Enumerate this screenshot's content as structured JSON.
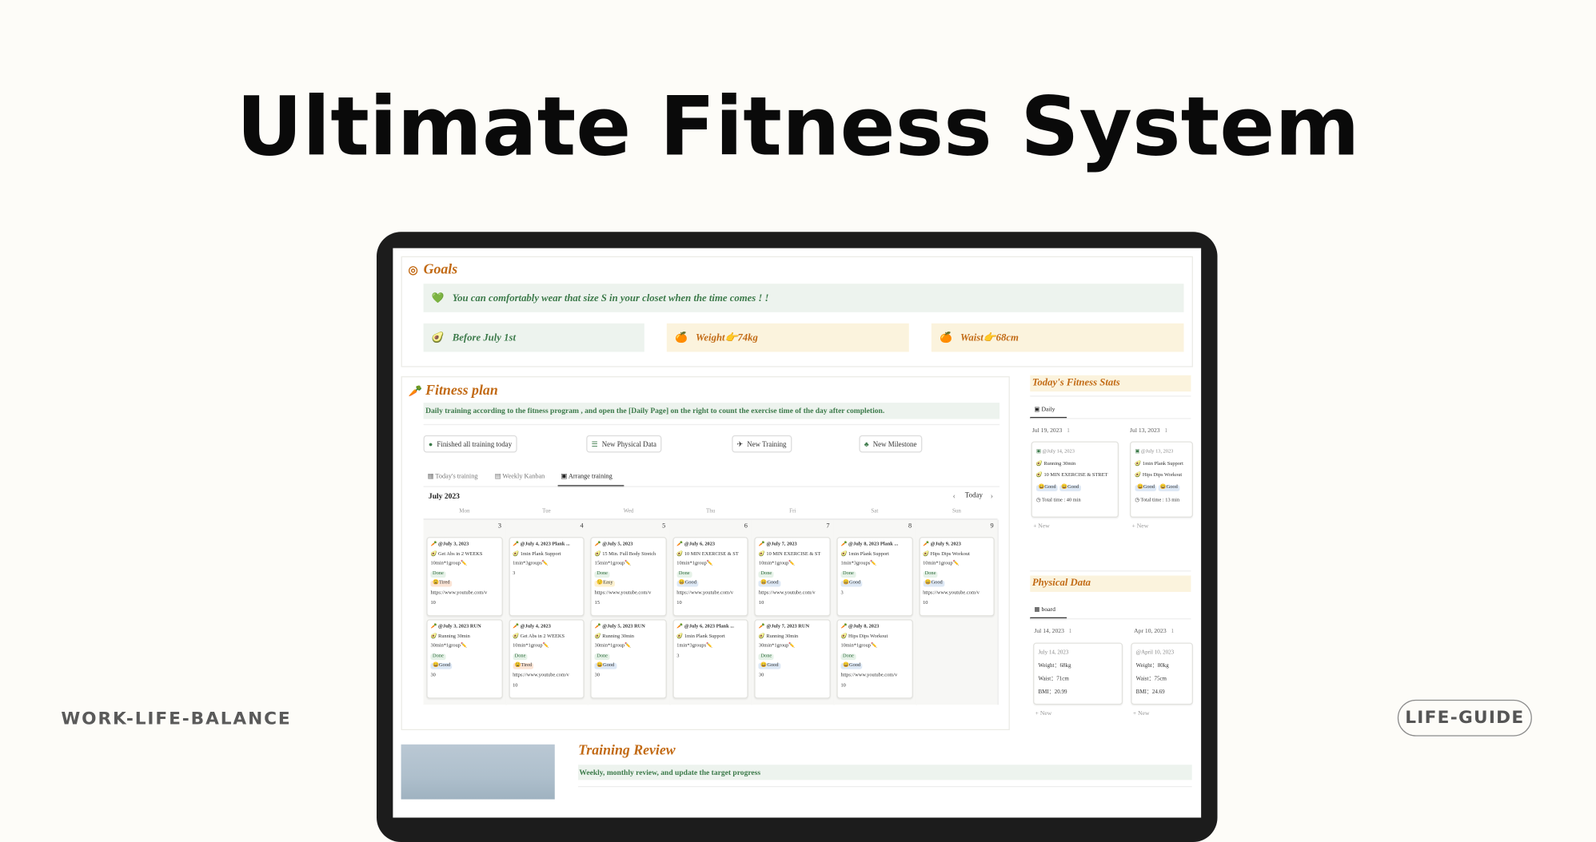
{
  "header": {
    "title": "Ultimate Fitness System"
  },
  "brand": {
    "left": "WORK-LIFE-BALANCE",
    "right": "LIFE-GUIDE"
  },
  "goals": {
    "title": "Goals",
    "banner": "You can comfortably wear that size S in your closet when the time comes ! !",
    "cards": [
      "Before July 1st",
      "Weight👉74kg",
      "Waist👉68cm"
    ]
  },
  "plan": {
    "title": "Fitness plan",
    "desc": "Daily training according to the fitness program , and open the [Daily Page] on the right to count the exercise time of the day after completion.",
    "buttons": [
      "Finished all training today",
      "New Physical Data",
      "New Training",
      "New Milestone"
    ],
    "tabs": [
      "Today's training",
      "Weekly Kanban",
      "Arrange training"
    ],
    "month": "July 2023",
    "today": "Today",
    "weekdays": [
      "Mon",
      "Tue",
      "Wed",
      "Thu",
      "Fri",
      "Sat",
      "Sun"
    ],
    "days": [
      "3",
      "4",
      "5",
      "6",
      "7",
      "8",
      "9"
    ],
    "row1": [
      {
        "t": "@July 3, 2023",
        "e": "Get Abs in 2 WEEKS",
        "r": "10min*1group✏️",
        "s": "Done",
        "f": "😩Tired",
        "u": "https://www.youtube.com/v",
        "n": "10"
      },
      {
        "t": "@July 4, 2023 Plank ...",
        "e": "1min Plank Support",
        "r": "1min*3groups✏️",
        "s": "",
        "f": "",
        "u": "",
        "n": "3"
      },
      {
        "t": "@July 5, 2023",
        "e": "15 Min. Full Body Stretch",
        "r": "15min*1group✏️",
        "s": "Done",
        "f": "😌Easy",
        "u": "https://www.youtube.com/v",
        "n": "15"
      },
      {
        "t": "@July 6, 2023",
        "e": "10 MIN EXERCISE & ST",
        "r": "10min*1group✏️",
        "s": "Done",
        "f": "😄Good",
        "u": "https://www.youtube.com/v",
        "n": "10"
      },
      {
        "t": "@July 7, 2023",
        "e": "10 MIN EXERCISE & ST",
        "r": "10min*1group✏️",
        "s": "Done",
        "f": "😄Good",
        "u": "https://www.youtube.com/v",
        "n": "10"
      },
      {
        "t": "@July 8, 2023 Plank ...",
        "e": "1min Plank Support",
        "r": "1min*3groups✏️",
        "s": "Done",
        "f": "😄Good",
        "u": "",
        "n": "3"
      },
      {
        "t": "@July 9, 2023",
        "e": "Hips Dips Workout",
        "r": "10min*1group✏️",
        "s": "Done",
        "f": "😄Good",
        "u": "https://www.youtube.com/v",
        "n": "10"
      }
    ],
    "row1_extra": {
      "s": "Done",
      "f": "😄Good"
    },
    "row2": [
      {
        "t": "@July 3, 2023 RUN",
        "e": "Running 30min",
        "r": "30min*1group✏️",
        "s": "Done",
        "f": "😄Good",
        "u": "",
        "n": "30"
      },
      {
        "t": "@July 4, 2023",
        "e": "Get Abs in 2 WEEKS",
        "r": "10min*1group✏️",
        "s": "Done",
        "f": "😩Tired",
        "u": "https://www.youtube.com/v",
        "n": "10"
      },
      {
        "t": "@July 5, 2023 RUN",
        "e": "Running 30min",
        "r": "30min*1group✏️",
        "s": "Done",
        "f": "😄Good",
        "u": "",
        "n": "30"
      },
      {
        "t": "@July 6, 2023 Plank ...",
        "e": "1min Plank Support",
        "r": "1min*3groups✏️",
        "s": "",
        "f": "",
        "u": "",
        "n": "3"
      },
      {
        "t": "@July 7, 2023 RUN",
        "e": "Running 30min",
        "r": "30min*1group✏️",
        "s": "Done",
        "f": "😄Good",
        "u": "",
        "n": "30"
      },
      {
        "t": "@July 8, 2023",
        "e": "Hips Dips Workout",
        "r": "10min*1group✏️",
        "s": "Done",
        "f": "😄Good",
        "u": "https://www.youtube.com/v",
        "n": "10"
      }
    ],
    "row2_extra": {
      "s": "Done",
      "f": "😄Good"
    }
  },
  "stats": {
    "title": "Today's Fitness Stats",
    "tab": "Daily",
    "groups": [
      {
        "date": "Jul 19, 2023",
        "count": "1",
        "card": {
          "t": "@July 14, 2023",
          "a": "Running 30min",
          "b": "10 MIN EXERCISE & STRET",
          "c": "😄Good",
          "d": "😄Good",
          "e": "Total time : 40 min"
        }
      },
      {
        "date": "Jul 13, 2023",
        "count": "1",
        "card": {
          "t": "@July 13, 2023",
          "a": "1min Plank Support",
          "b": "Hips Dips Workout",
          "c": "😄Good",
          "d": "😄Good",
          "e": "Total time : 13 min"
        }
      }
    ],
    "new": "+ New"
  },
  "physical": {
    "title": "Physical Data",
    "tab": "board",
    "groups": [
      {
        "date": "Jul 14, 2023",
        "count": "1",
        "card": {
          "t": "July 14, 2023",
          "a": "Weight：68kg",
          "b": "Waist：71cm",
          "c": "BMI：20.99"
        }
      },
      {
        "date": "Apr 10, 2023",
        "count": "1",
        "card": {
          "t": "@April 10, 2023",
          "a": "Weight：80kg",
          "b": "Waist：75cm",
          "c": "BMI：24.69"
        }
      }
    ],
    "new": "+ New"
  },
  "review": {
    "title": "Training Review",
    "desc": "Weekly, monthly review, and update the target progress"
  },
  "colors": {
    "accent": "#c26a14",
    "green": "#3c7a4a",
    "paleGreen": "#edf3ee",
    "paleOrange": "#fbf3dd"
  }
}
